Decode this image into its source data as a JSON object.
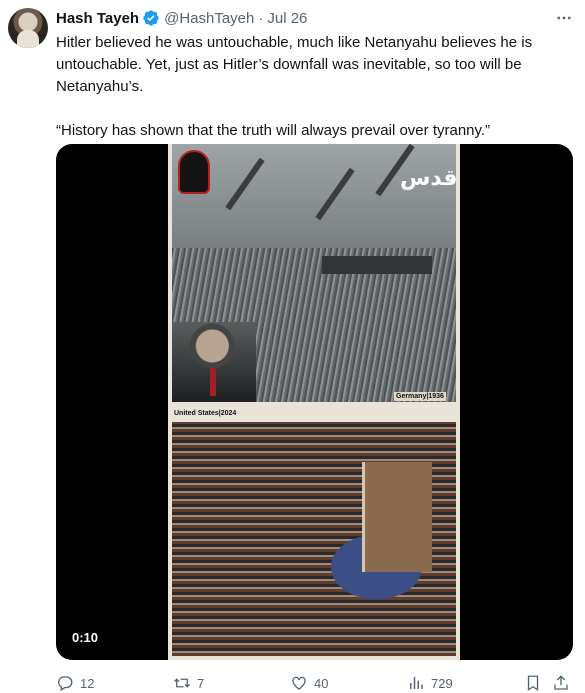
{
  "author": {
    "name": "Hash Tayeh",
    "handle": "@HashTayeh",
    "separator": "·",
    "date": "Jul 26",
    "verified": true
  },
  "tweet": {
    "paragraph1": "Hitler believed he was untouchable, much like Netanyahu believes he is untouchable. Yet, just as Hitler’s downfall was inevitable, so too will be Netanyahu’s.",
    "paragraph2": "“History has shown that the truth will always prevail over tyranny.”"
  },
  "media": {
    "video_time": "0:10",
    "overlay_logo": "قدس",
    "label_top": "Germany|1936",
    "label_bottom": "United States|2024"
  },
  "actions": {
    "replies": "12",
    "reposts": "7",
    "likes": "40",
    "views": "729"
  },
  "icons": [
    "more-icon",
    "verified-icon",
    "reply-icon",
    "repost-icon",
    "like-icon",
    "views-icon",
    "bookmark-icon",
    "share-icon"
  ],
  "colors": {
    "text": "#0f1419",
    "secondary": "#536471",
    "verified": "#1d9bf0"
  }
}
